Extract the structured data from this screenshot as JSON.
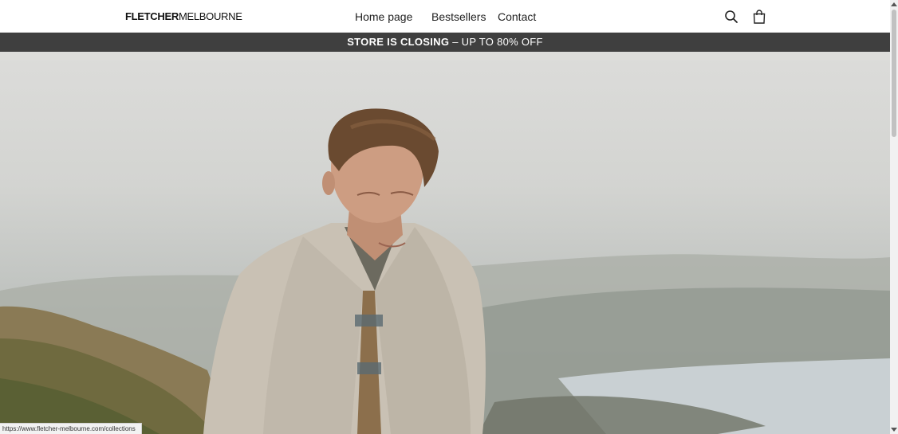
{
  "header": {
    "logo_bold": "FLETCHER",
    "logo_light": "MELBOURNE",
    "nav": [
      {
        "label": "Home page"
      },
      {
        "label": "Bestsellers"
      },
      {
        "label": "Contact"
      }
    ],
    "icons": {
      "search": "search-icon",
      "cart": "shopping-bag-icon"
    }
  },
  "announcement": {
    "strong": "STORE IS CLOSING",
    "rest": " – UP TO 80% OFF"
  },
  "hero": {
    "image": "man-in-grey-wool-overshirt-coastal-landscape"
  },
  "status_bar": {
    "url": "https://www.fletcher-melbourne.com/collections"
  },
  "colors": {
    "announcement_bg": "#3f3f3f",
    "text": "#222222"
  }
}
